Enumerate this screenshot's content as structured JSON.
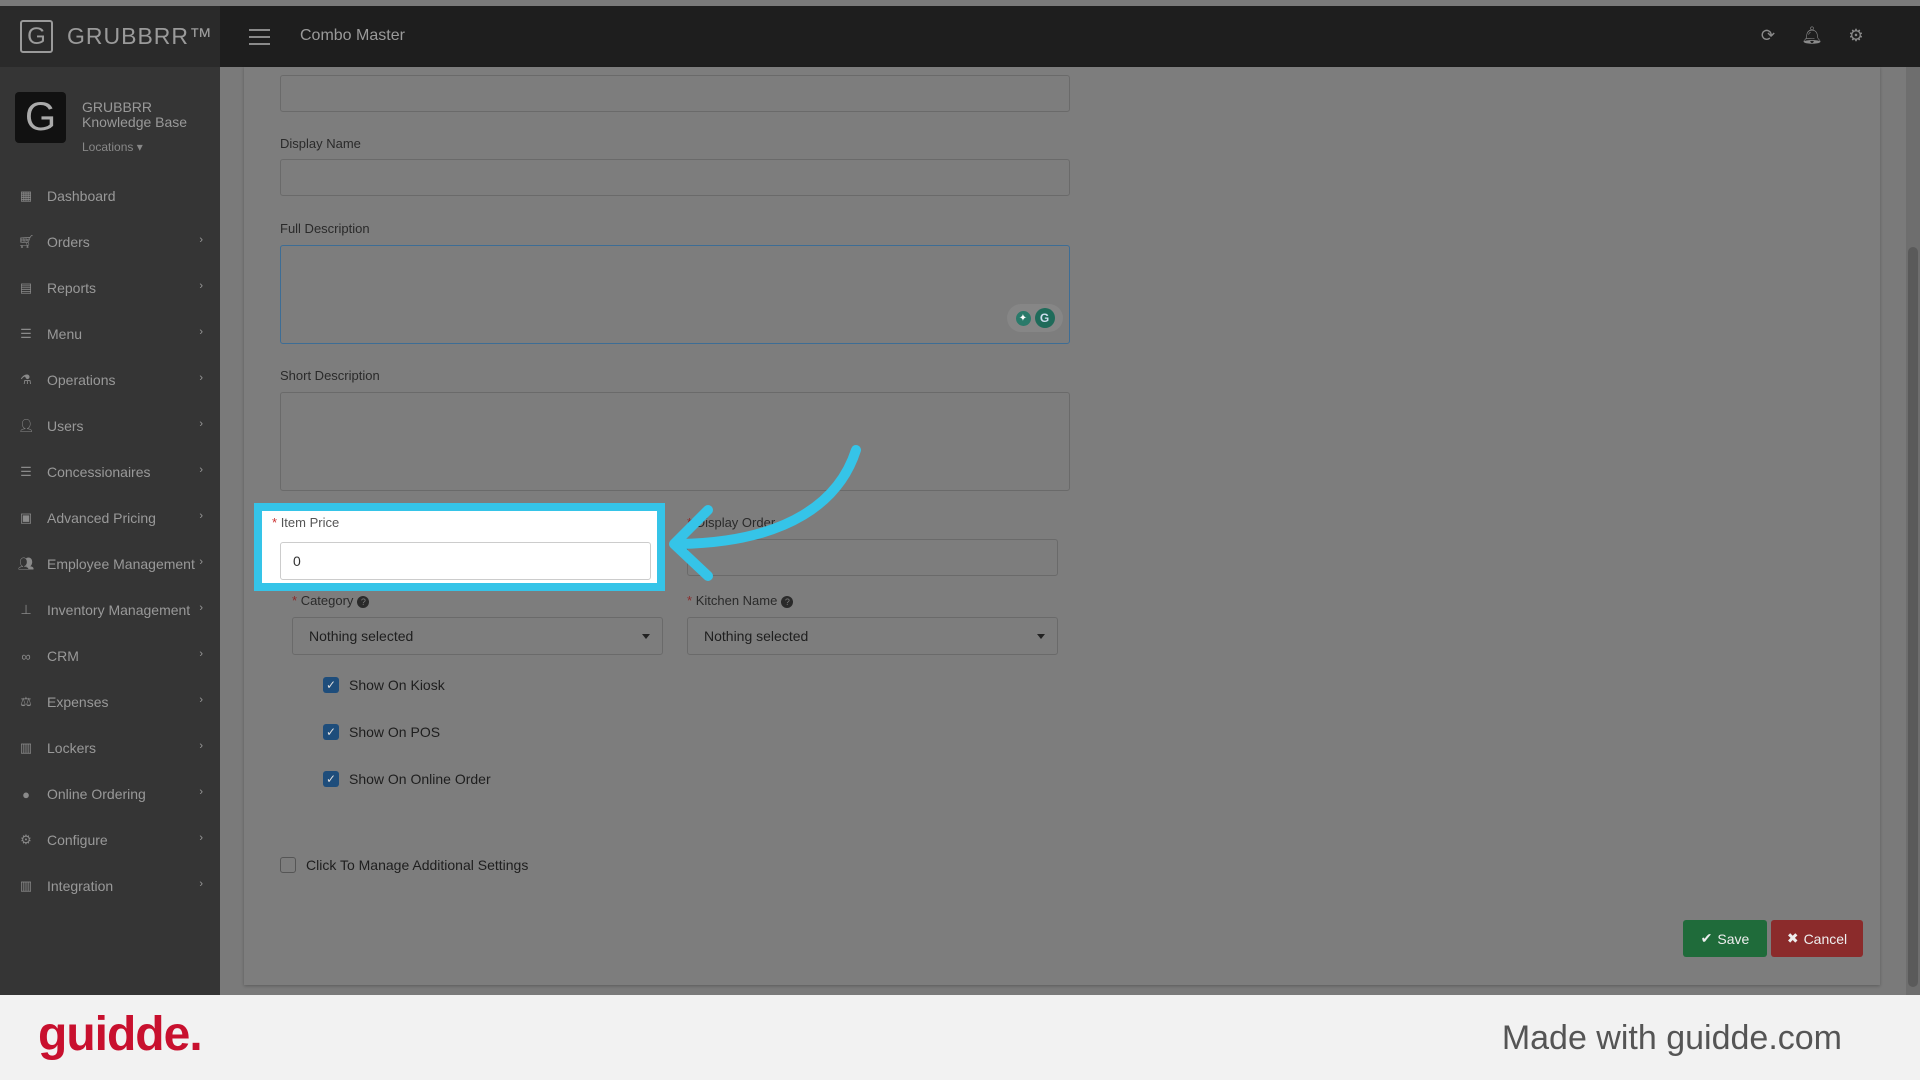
{
  "app": {
    "brand": "GRUBBRR™",
    "page_title": "Combo Master",
    "top_icons": [
      "refresh-icon",
      "bell-icon",
      "gear-icon"
    ]
  },
  "profile": {
    "avatar_letter": "G",
    "org_name": "GRUBBRR Knowledge Base",
    "locations_label": "Locations"
  },
  "sidebar": {
    "items": [
      {
        "label": "Dashboard",
        "icon": "dashboard-icon",
        "has_children": false
      },
      {
        "label": "Orders",
        "icon": "cart-icon",
        "has_children": true
      },
      {
        "label": "Reports",
        "icon": "report-icon",
        "has_children": true
      },
      {
        "label": "Menu",
        "icon": "menu-list-icon",
        "has_children": true
      },
      {
        "label": "Operations",
        "icon": "flask-icon",
        "has_children": true
      },
      {
        "label": "Users",
        "icon": "user-add-icon",
        "has_children": true
      },
      {
        "label": "Concessionaires",
        "icon": "list-icon",
        "has_children": true
      },
      {
        "label": "Advanced Pricing",
        "icon": "money-icon",
        "has_children": true
      },
      {
        "label": "Employee Management",
        "icon": "users-icon",
        "has_children": true
      },
      {
        "label": "Inventory Management",
        "icon": "sitemap-icon",
        "has_children": true
      },
      {
        "label": "CRM",
        "icon": "link-icon",
        "has_children": true
      },
      {
        "label": "Expenses",
        "icon": "balance-icon",
        "has_children": true
      },
      {
        "label": "Lockers",
        "icon": "locker-icon",
        "has_children": true
      },
      {
        "label": "Online Ordering",
        "icon": "globe-icon",
        "has_children": true
      },
      {
        "label": "Configure",
        "icon": "cog-icon",
        "has_children": true
      },
      {
        "label": "Integration",
        "icon": "plug-icon",
        "has_children": true
      }
    ]
  },
  "form": {
    "top_input_value": "",
    "display_name": {
      "label": "Display Name",
      "value": ""
    },
    "full_description": {
      "label": "Full Description",
      "value": ""
    },
    "short_description": {
      "label": "Short Description",
      "value": ""
    },
    "item_price": {
      "label": "Item Price",
      "value": "0",
      "required": true
    },
    "display_order": {
      "label": "Display Order",
      "value": "",
      "required": true
    },
    "category": {
      "label": "Category",
      "selected": "Nothing selected",
      "required": true
    },
    "kitchen_name": {
      "label": "Kitchen Name",
      "selected": "Nothing selected",
      "required": true
    },
    "checkboxes": [
      {
        "label": "Show On Kiosk",
        "checked": true
      },
      {
        "label": "Show On POS",
        "checked": true
      },
      {
        "label": "Show On Online Order",
        "checked": true
      }
    ],
    "additional_settings": {
      "label": "Click To Manage Additional Settings",
      "checked": false
    },
    "save_label": "Save",
    "cancel_label": "Cancel"
  },
  "footer": {
    "logo": "guidde.",
    "made_with": "Made with guidde.com"
  },
  "colors": {
    "highlight": "#35c4e8",
    "save": "#1f6b3a",
    "cancel": "#8b2b2b",
    "brand_red": "#c8102e"
  }
}
